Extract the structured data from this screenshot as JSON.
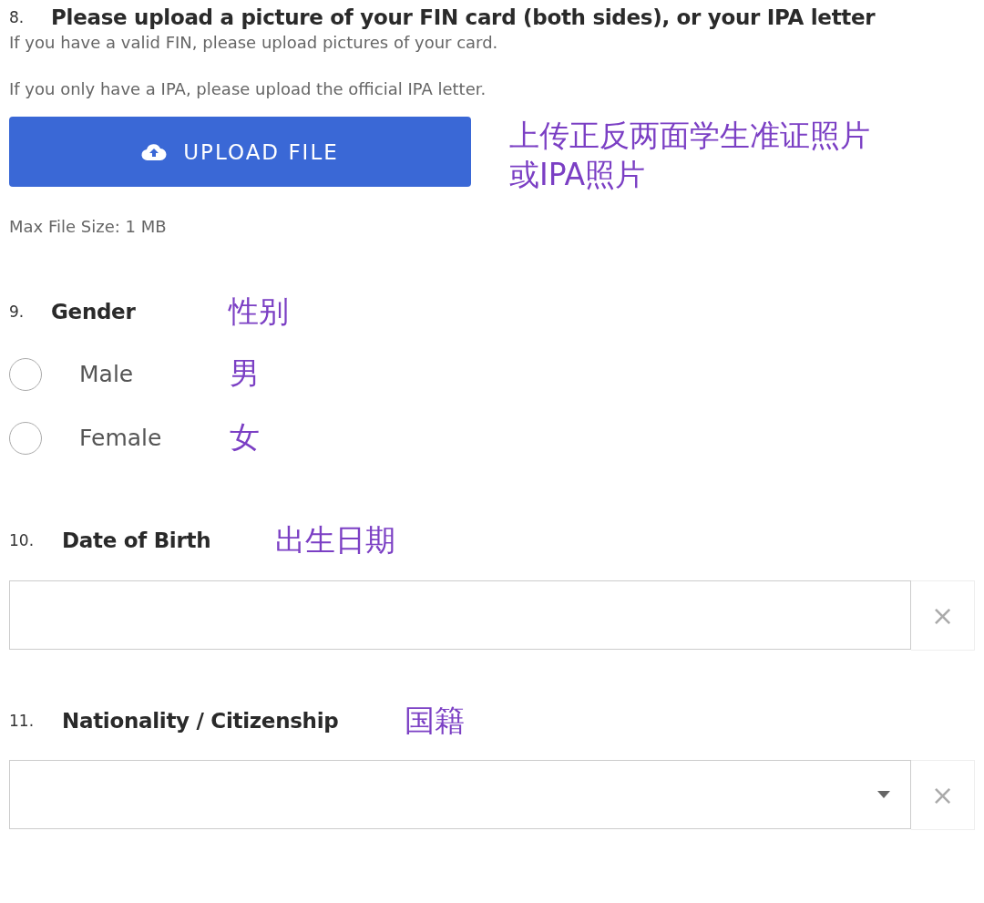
{
  "questions": [
    {
      "kind": "upload",
      "number": "8.",
      "label": "Please upload a picture of your FIN card (both sides), or your IPA letter",
      "descriptions": [
        "If you have a valid FIN, please upload pictures of your card.",
        "If you only have a IPA, please upload the official IPA letter."
      ],
      "button": "UPLOAD FILE",
      "hint": "Max File Size: 1 MB",
      "annotation_lines": [
        "上传正反两面学生准证照片",
        "或IPA照片"
      ]
    },
    {
      "kind": "radio",
      "number": "9.",
      "label": "Gender",
      "annotation": "性别",
      "options": [
        {
          "label": "Male",
          "selected": false,
          "annotation": "男"
        },
        {
          "label": "Female",
          "selected": false,
          "annotation": "女"
        }
      ]
    },
    {
      "kind": "date",
      "number": "10.",
      "label": "Date of Birth",
      "annotation": "出生日期",
      "clear": "×"
    },
    {
      "kind": "select",
      "number": "11.",
      "label": "Nationality / Citizenship",
      "annotation": "国籍",
      "clear": "×"
    }
  ]
}
